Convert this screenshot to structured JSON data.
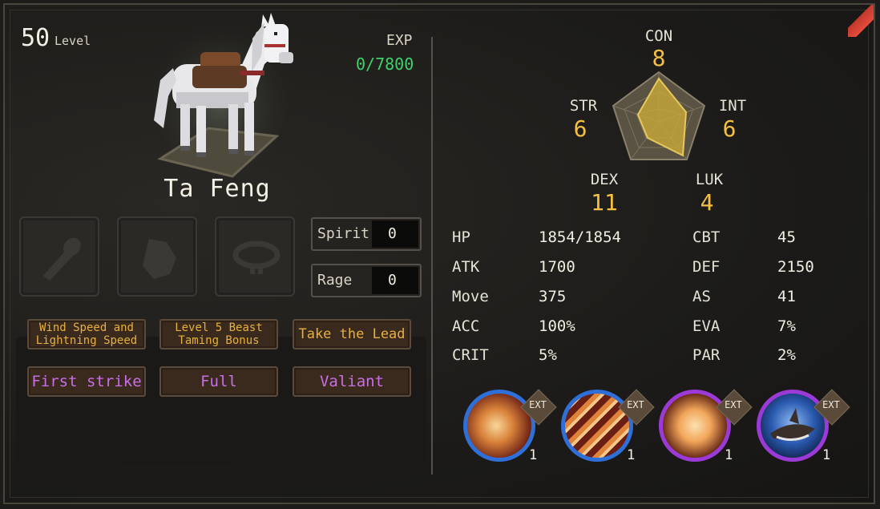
{
  "pet": {
    "level": "50",
    "level_label": "Level",
    "exp_label": "EXP",
    "exp_value": "0/7800",
    "name": "Ta Feng"
  },
  "equipment": {
    "slots": [
      {
        "icon": "brush-icon"
      },
      {
        "icon": "saddle-icon"
      },
      {
        "icon": "collar-icon"
      }
    ]
  },
  "resources": {
    "spirit_label": "Spirit",
    "spirit_value": "0",
    "rage_label": "Rage",
    "rage_value": "0"
  },
  "traits": {
    "gold": [
      "Wind Speed and Lightning Speed",
      "Level 5 Beast Taming Bonus",
      "Take the Lead"
    ],
    "purple": [
      "First strike",
      "Full",
      "Valiant"
    ]
  },
  "attributes": {
    "con_label": "CON",
    "con": "8",
    "str_label": "STR",
    "str": "6",
    "int_label": "INT",
    "int": "6",
    "dex_label": "DEX",
    "dex": "11",
    "luk_label": "LUK",
    "luk": "4"
  },
  "stats": {
    "left": [
      {
        "name": "HP",
        "value": "1854/1854"
      },
      {
        "name": "ATK",
        "value": "1700"
      },
      {
        "name": "Move",
        "value": "375"
      },
      {
        "name": "ACC",
        "value": "100%"
      },
      {
        "name": "CRIT",
        "value": "5%"
      }
    ],
    "right": [
      {
        "name": "CBT",
        "value": "45"
      },
      {
        "name": "DEF",
        "value": "2150"
      },
      {
        "name": "AS",
        "value": "41"
      },
      {
        "name": "EVA",
        "value": "7%"
      },
      {
        "name": "PAR",
        "value": "2%"
      }
    ]
  },
  "skills": [
    {
      "tag": "EXT",
      "count": "1",
      "ring": "#2f6fd8",
      "icon": "pillar-strike-icon"
    },
    {
      "tag": "EXT",
      "count": "1",
      "ring": "#2f6fd8",
      "icon": "slash-burst-icon"
    },
    {
      "tag": "EXT",
      "count": "1",
      "ring": "#9b3ad6",
      "icon": "explosion-icon"
    },
    {
      "tag": "EXT",
      "count": "1",
      "ring": "#9b3ad6",
      "icon": "shark-icon"
    }
  ],
  "colors": {
    "exp": "#3fd16a",
    "attribute_value": "#f5c042",
    "trait_gold": "#e6b040",
    "trait_purple": "#c86ee6"
  }
}
